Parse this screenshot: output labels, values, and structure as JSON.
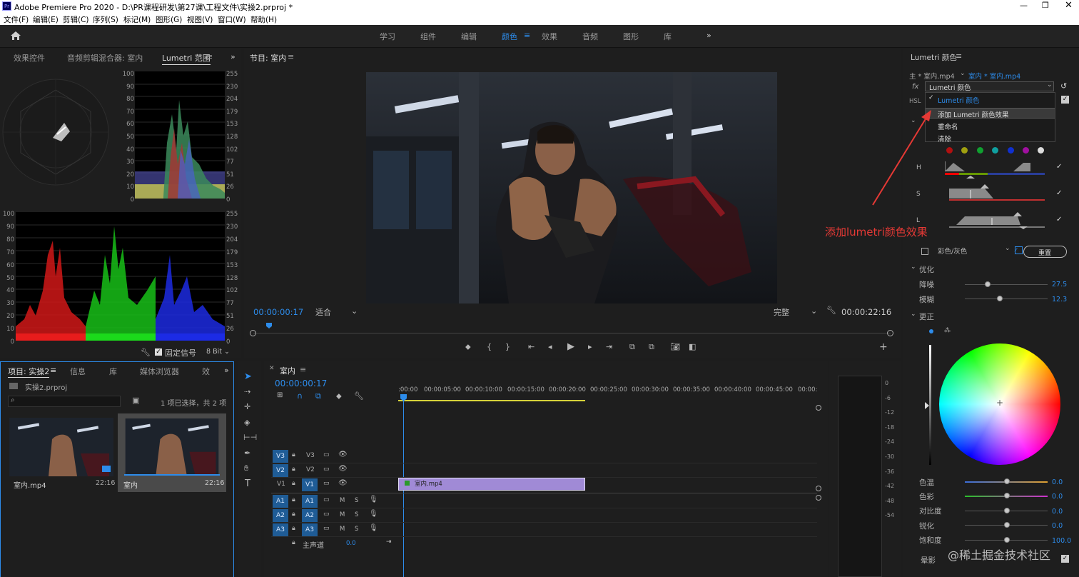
{
  "window": {
    "app_title": "Adobe Premiere Pro 2020 - D:\\PR课程研发\\第27课\\工程文件\\实操2.prproj *"
  },
  "menu": [
    "文件(F)",
    "编辑(E)",
    "剪辑(C)",
    "序列(S)",
    "标记(M)",
    "图形(G)",
    "视图(V)",
    "窗口(W)",
    "帮助(H)"
  ],
  "workspaces": [
    "学习",
    "组件",
    "编辑",
    "颜色",
    "效果",
    "音频",
    "图形",
    "库"
  ],
  "active_workspace": "颜色",
  "scopes_panel": {
    "tabs": [
      "效果控件",
      "音频剪辑混合器: 室内",
      "Lumetri 范围"
    ],
    "parade_ticks_left": [
      "100",
      "90",
      "80",
      "70",
      "60",
      "50",
      "40",
      "30",
      "20",
      "10",
      "0"
    ],
    "parade_ticks_right": [
      "255",
      "230",
      "204",
      "179",
      "153",
      "128",
      "102",
      "77",
      "51",
      "26",
      "0"
    ],
    "fixed_signal": "固定信号",
    "bit_depth": "8 Bit"
  },
  "program_monitor": {
    "title": "节目: 室内",
    "timecode": "00:00:00:17",
    "fit": "适合",
    "quality": "完整",
    "duration": "00:00:22:16"
  },
  "project_panel": {
    "tabs": [
      "项目: 实操2",
      "信息",
      "库",
      "媒体浏览器",
      "效"
    ],
    "file": "实操2.prproj",
    "selection_info": "1 项已选择，共 2 项",
    "items": [
      {
        "name": "室内.mp4",
        "duration": "22:16"
      },
      {
        "name": "室内",
        "duration": "22:16"
      }
    ]
  },
  "timeline": {
    "title": "室内",
    "timecode": "00:00:00:17",
    "ruler": [
      ":00:00",
      "00:00:05:00",
      "00:00:10:00",
      "00:00:15:00",
      "00:00:20:00",
      "00:00:25:00",
      "00:00:30:00",
      "00:00:35:00",
      "00:00:40:00",
      "00:00:45:00",
      "00:00:"
    ],
    "video_tracks": [
      {
        "src": "V3",
        "label": "V3"
      },
      {
        "src": "V2",
        "label": "V2"
      },
      {
        "src": "V1",
        "label": "V1"
      }
    ],
    "audio_tracks": [
      {
        "src": "A1",
        "label": "A1"
      },
      {
        "src": "A2",
        "label": "A2"
      },
      {
        "src": "A3",
        "label": "A3"
      }
    ],
    "clip_name": "室内.mp4",
    "master": "主声道",
    "master_value": "0.0",
    "meter_ticks": [
      "0",
      "-6",
      "-12",
      "-18",
      "-24",
      "-30",
      "-36",
      "-42",
      "-48",
      "-54"
    ],
    "track_buttons": {
      "m": "M",
      "s": "S"
    }
  },
  "lumetri": {
    "title": "Lumetri 颜色",
    "source_main": "主 * 室内.mp4",
    "source_seq": "室内 * 室内.mp4",
    "fx": "fx",
    "effect_select": "Lumetri 颜色",
    "hsl_label": "HSL",
    "dropdown": {
      "checked_item": "Lumetri 颜色",
      "items": [
        "添加 Lumetri 颜色效果",
        "重命名",
        "清除"
      ]
    },
    "hsl_rows": [
      "H",
      "S",
      "L"
    ],
    "color_gray": "彩色/灰色",
    "reset": "重置",
    "refine_section": "优化",
    "denoise": {
      "label": "降噪",
      "value": "27.5"
    },
    "blur": {
      "label": "模糊",
      "value": "12.3"
    },
    "correct_section": "更正",
    "sliders": [
      {
        "label": "色温",
        "value": "0.0"
      },
      {
        "label": "色彩",
        "value": "0.0"
      },
      {
        "label": "对比度",
        "value": "0.0"
      },
      {
        "label": "锐化",
        "value": "0.0"
      },
      {
        "label": "饱和度",
        "value": "100.0"
      }
    ],
    "vignette": "晕影"
  },
  "annotation": {
    "text": "添加lumetri颜色效果",
    "color": "#e53935"
  },
  "watermark": "@稀土掘金技术社区",
  "colors": {
    "accent": "#2d8ceb",
    "clip": "#a08ad6",
    "track_button": "#1f5c96"
  }
}
